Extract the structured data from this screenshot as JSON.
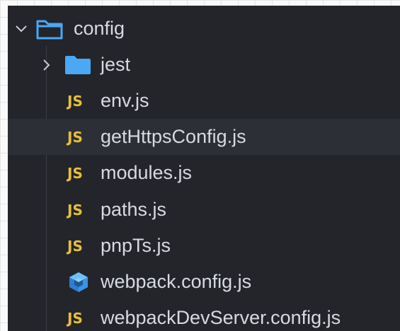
{
  "explorer": {
    "root": {
      "label": "config",
      "icon": "folder-outline-icon",
      "expanded": true
    },
    "children": [
      {
        "label": "jest",
        "type": "folder",
        "icon": "folder-filled-icon",
        "expanded": false
      },
      {
        "label": "env.js",
        "type": "file",
        "icon": "js-icon",
        "icon_text": "JS"
      },
      {
        "label": "getHttpsConfig.js",
        "type": "file",
        "icon": "js-icon",
        "icon_text": "JS",
        "hovered": true
      },
      {
        "label": "modules.js",
        "type": "file",
        "icon": "js-icon",
        "icon_text": "JS"
      },
      {
        "label": "paths.js",
        "type": "file",
        "icon": "js-icon",
        "icon_text": "JS"
      },
      {
        "label": "pnpTs.js",
        "type": "file",
        "icon": "js-icon",
        "icon_text": "JS"
      },
      {
        "label": "webpack.config.js",
        "type": "file",
        "icon": "webpack-cube-icon"
      },
      {
        "label": "webpackDevServer.config.js",
        "type": "file",
        "icon": "js-icon",
        "icon_text": "JS"
      }
    ]
  },
  "colors": {
    "panel_bg": "#23252b",
    "hover_bg": "#2c2f36",
    "text": "#d7dae0",
    "js_icon": "#e8bf3a",
    "folder_icon": "#4aa8f5",
    "webpack_icon": "#4aa8f5"
  }
}
